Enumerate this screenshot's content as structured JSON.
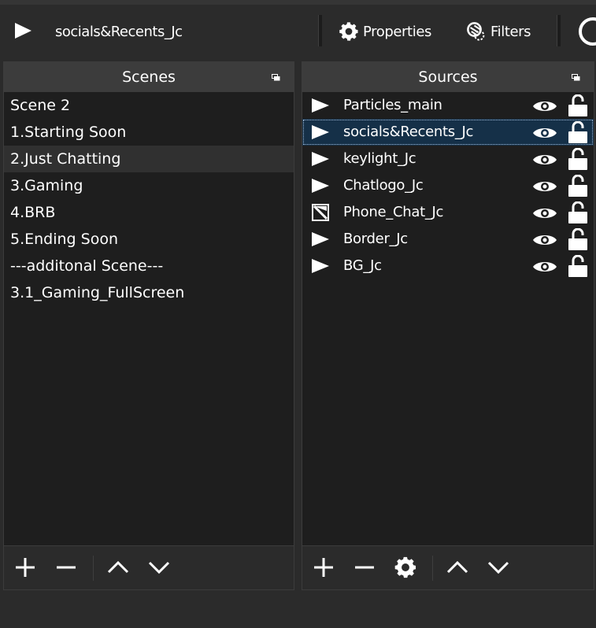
{
  "toolbar": {
    "source_name": "socials&Recents_Jc",
    "properties_label": "Properties",
    "filters_label": "Filters"
  },
  "scenes": {
    "title": "Scenes",
    "items": [
      "Scene 2",
      "1.Starting Soon",
      "2.Just Chatting",
      "3.Gaming",
      "4.BRB",
      "5.Ending Soon",
      "---additonal Scene---",
      "3.1_Gaming_FullScreen"
    ],
    "selected": "2.Just Chatting"
  },
  "sources": {
    "title": "Sources",
    "items": [
      {
        "name": "Particles_main",
        "icon": "play-icon",
        "visible": true,
        "locked": false
      },
      {
        "name": "socials&Recents_Jc",
        "icon": "play-icon",
        "visible": true,
        "locked": false,
        "selected": true
      },
      {
        "name": "keylight_Jc",
        "icon": "play-icon",
        "visible": true,
        "locked": false
      },
      {
        "name": "Chatlogo_Jc",
        "icon": "play-icon",
        "visible": true,
        "locked": false
      },
      {
        "name": "Phone_Chat_Jc",
        "icon": "image-icon",
        "visible": true,
        "locked": false
      },
      {
        "name": "Border_Jc",
        "icon": "play-icon",
        "visible": true,
        "locked": false
      },
      {
        "name": "BG_Jc",
        "icon": "play-icon",
        "visible": true,
        "locked": false
      }
    ]
  },
  "colors": {
    "background": "#2b2b2b",
    "panel": "#1e1e1e",
    "header": "#3c3c3c",
    "selection": "#153048"
  }
}
